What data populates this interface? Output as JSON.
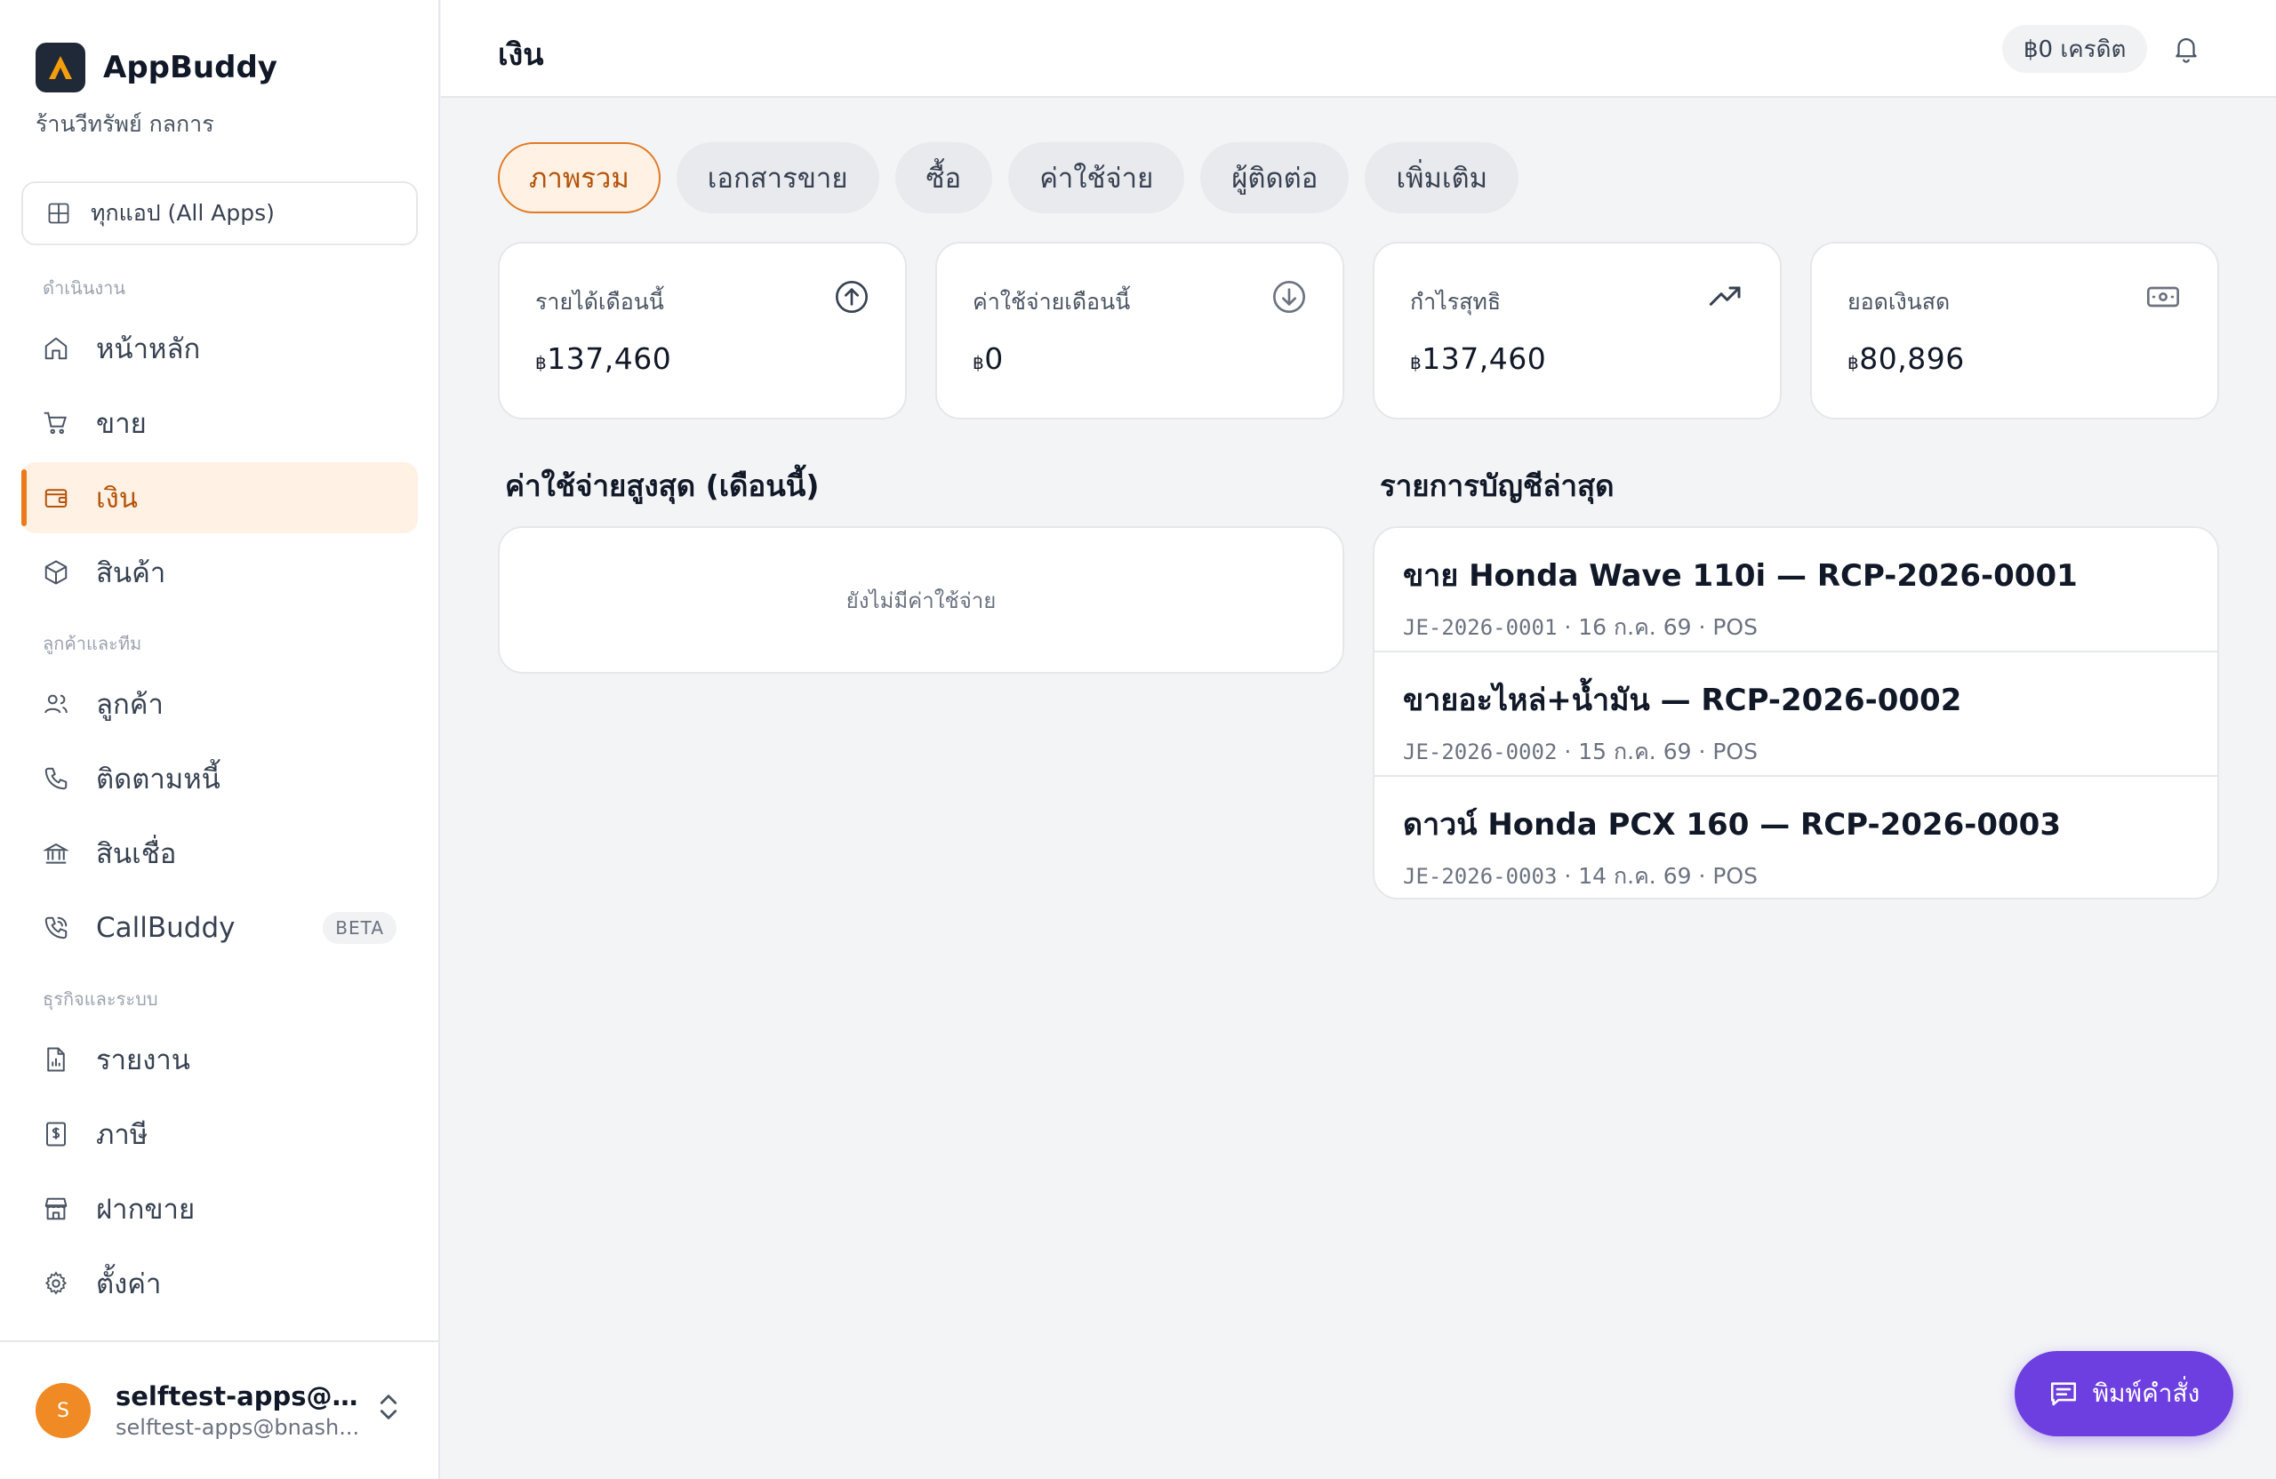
{
  "brand": {
    "name": "AppBuddy",
    "store": "ร้านวีทรัพย์ กลการ"
  },
  "all_apps": {
    "label": "ทุกแอป (All Apps)"
  },
  "sidebar": {
    "sections": [
      "ดำเนินงาน",
      "ลูกค้าและทีม",
      "ธุรกิจและระบบ"
    ],
    "items": [
      {
        "label": "หน้าหลัก",
        "icon": "home-icon"
      },
      {
        "label": "ขาย",
        "icon": "cart-icon"
      },
      {
        "label": "เงิน",
        "icon": "wallet-icon",
        "active": true
      },
      {
        "label": "สินค้า",
        "icon": "box-icon"
      },
      {
        "label": "ลูกค้า",
        "icon": "users-icon"
      },
      {
        "label": "ติดตามหนี้",
        "icon": "phone-icon"
      },
      {
        "label": "สินเชื่อ",
        "icon": "bank-icon"
      },
      {
        "label": "CallBuddy",
        "icon": "phone-call-icon",
        "badge": "BETA"
      },
      {
        "label": "รายงาน",
        "icon": "report-icon"
      },
      {
        "label": "ภาษี",
        "icon": "tax-icon"
      },
      {
        "label": "ฝากขาย",
        "icon": "store-icon"
      },
      {
        "label": "ตั้งค่า",
        "icon": "gear-icon"
      }
    ]
  },
  "user": {
    "initial": "S",
    "name": "selftest-apps@bn...",
    "email": "selftest-apps@bnash..."
  },
  "header": {
    "title": "เงิน",
    "credit": "฿0 เครดิต"
  },
  "tabs": [
    {
      "label": "ภาพรวม",
      "active": true
    },
    {
      "label": "เอกสารขาย"
    },
    {
      "label": "ซื้อ"
    },
    {
      "label": "ค่าใช้จ่าย"
    },
    {
      "label": "ผู้ติดต่อ"
    },
    {
      "label": "เพิ่มเติม"
    }
  ],
  "kpis": [
    {
      "label": "รายได้เดือนนี้",
      "currency": "฿",
      "value": "137,460",
      "icon": "arrow-up-circle-icon"
    },
    {
      "label": "ค่าใช้จ่ายเดือนนี้",
      "currency": "฿",
      "value": "0",
      "icon": "arrow-down-circle-icon"
    },
    {
      "label": "กำไรสุทธิ",
      "currency": "฿",
      "value": "137,460",
      "icon": "trending-up-icon"
    },
    {
      "label": "ยอดเงินสด",
      "currency": "฿",
      "value": "80,896",
      "icon": "banknote-icon"
    }
  ],
  "top_expenses": {
    "title": "ค่าใช้จ่ายสูงสุด (เดือนนี้)",
    "empty": "ยังไม่มีค่าใช้จ่าย"
  },
  "journal": {
    "title": "รายการบัญชีล่าสุด",
    "entries": [
      {
        "title": "ขาย Honda Wave 110i — RCP-2026-0001",
        "code": "JE-2026-0001",
        "meta": " · 16 ก.ค. 69 · POS"
      },
      {
        "title": "ขายอะไหล่+น้ำมัน — RCP-2026-0002",
        "code": "JE-2026-0002",
        "meta": " · 15 ก.ค. 69 · POS"
      },
      {
        "title": "ดาวน์ Honda PCX 160 — RCP-2026-0003",
        "code": "JE-2026-0003",
        "meta": " · 14 ก.ค. 69 · POS"
      }
    ]
  },
  "fab": {
    "label": "พิมพ์คำสั่ง"
  },
  "colors": {
    "accent": "#ea7a1b",
    "fab": "#6d3fe0",
    "active_bg": "#fff1e3"
  }
}
